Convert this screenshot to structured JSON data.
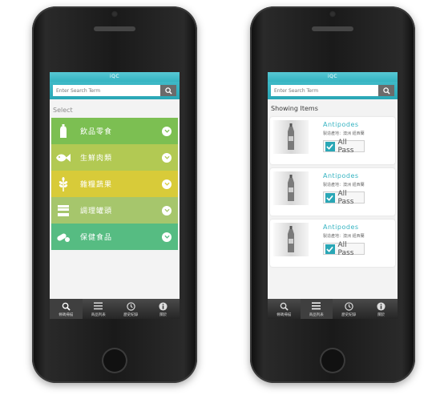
{
  "colors": {
    "accent": "#34b3c1",
    "cat_green": "#7cbf52",
    "cat_lime": "#b2c953",
    "cat_yellow": "#d8cb39",
    "cat_olive": "#a6c66c",
    "cat_teal": "#56bc82"
  },
  "left": {
    "title": "iQC",
    "search": {
      "placeholder": "Enter Search Term",
      "icon": "search-icon"
    },
    "select_label": "Select",
    "categories": [
      {
        "label": "飲品零食",
        "icon": "bottle-icon"
      },
      {
        "label": "生鮮肉類",
        "icon": "fish-icon"
      },
      {
        "label": "雜糧蔬果",
        "icon": "grain-icon"
      },
      {
        "label": "調理罐頭",
        "icon": "can-icon"
      },
      {
        "label": "保健食品",
        "icon": "pill-icon"
      }
    ],
    "tabs": [
      {
        "label": "條碼掃描",
        "icon": "search-icon"
      },
      {
        "label": "商品列表",
        "icon": "list-icon"
      },
      {
        "label": "歷史紀錄",
        "icon": "clock-icon"
      },
      {
        "label": "關於",
        "icon": "info-icon"
      }
    ]
  },
  "right": {
    "title": "iQC",
    "search": {
      "placeholder": "Enter Search Term",
      "icon": "search-icon"
    },
    "showing_label": "Showing Items",
    "items": [
      {
        "name": "Antipodes",
        "meta": "製造產地：澳洲 紐西蘭",
        "pass_label": "All Pass"
      },
      {
        "name": "Antipodes",
        "meta": "製造產地：澳洲 紐西蘭",
        "pass_label": "All Pass"
      },
      {
        "name": "Antipodes",
        "meta": "製造產地：澳洲 紐西蘭",
        "pass_label": "All Pass"
      }
    ],
    "tabs": [
      {
        "label": "條碼掃描",
        "icon": "search-icon"
      },
      {
        "label": "商品列表",
        "icon": "list-icon"
      },
      {
        "label": "歷史紀錄",
        "icon": "clock-icon"
      },
      {
        "label": "關於",
        "icon": "info-icon"
      }
    ]
  }
}
